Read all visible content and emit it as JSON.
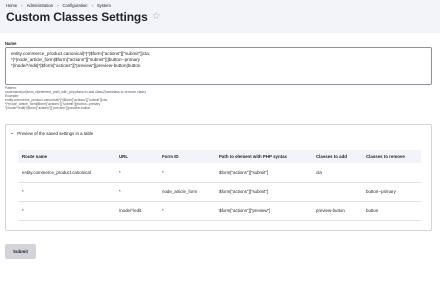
{
  "breadcrumb": [
    "Home",
    "Administration",
    "Configuration",
    "System"
  ],
  "page_title": "Custom Classes Settings",
  "star_icon": "star-outline-icon",
  "name_field": {
    "label": "Name",
    "value": "entity.commerce_product.canonical|*|*|$form[\"actions\"][\"submit\"]|cta;\n*|*|node_article_form|$form[\"actions\"][\"submit\"]||button--primary\n*|/node/*/edit|*|$form[\"actions\"][\"preview\"]|preview-button|button"
  },
  "help_lines": [
    "Pattern:",
    "routename|url|form_id|element_path_with_php|class-to-add class2|newclass-to-remove class|",
    "Example:",
    "entity.commerce_product.canonical|*|*|$form[\"actions\"][\"submit\"]|cta;",
    "*|*|node_article_form|$form[\"actions\"][\"submit\"]||button--primary",
    "*|/node/*/edit|*|$form[\"actions\"][\"preview\"]|preview-button"
  ],
  "preview": {
    "summary": "Preview of the saved settings in a table",
    "columns": [
      "Route name",
      "URL",
      "Form ID",
      "Path to element with PHP syntax",
      "Classes to add",
      "Classes to remove"
    ],
    "rows": [
      [
        "entity.commerce_product.canonical",
        "*",
        "*",
        "$form[\"actions\"][\"submit\"]",
        "cta",
        ""
      ],
      [
        "*",
        "*",
        "node_article_form",
        "$form[\"actions\"][\"submit\"]",
        "",
        "button--primary"
      ],
      [
        "*",
        "/node/*/edit",
        "*",
        "$form[\"actions\"][\"preview\"]",
        "preview-button",
        "button"
      ]
    ]
  },
  "submit_label": "Submit"
}
